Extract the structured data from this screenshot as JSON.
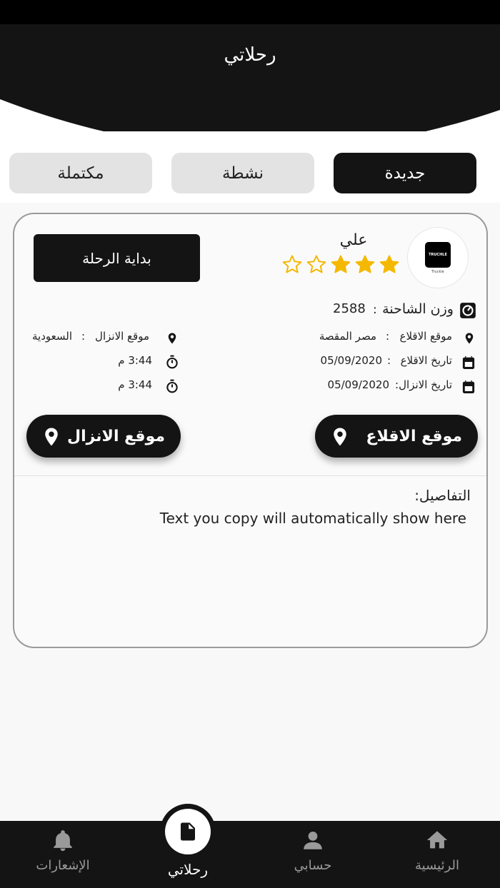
{
  "header": {
    "title": "رحلاتي"
  },
  "tabs": [
    {
      "label": "جديدة",
      "active": true
    },
    {
      "label": "نشطة",
      "active": false
    },
    {
      "label": "مكتملة",
      "active": false
    }
  ],
  "trip": {
    "driver_name": "علي",
    "rating": 3,
    "rating_max": 5,
    "logo_text": "TRUCHLE",
    "logo_subtext": "Truckle",
    "start_button": "بداية الرحلة",
    "truck_weight_label": "وزن الشاحنة",
    "truck_weight_value": "2588",
    "separator": ":",
    "pickup_label": "موقع الاقلاع",
    "pickup_value": "مصر المقصة",
    "dropoff_label": "موقع الانزال",
    "dropoff_value": "السعودية",
    "pickup_date_label": "تاريخ الاقلاع",
    "pickup_date_value": "05/09/2020",
    "dropoff_date_label": "تاريخ الانزال",
    "dropoff_date_value": "05/09/2020",
    "pickup_time": "3:44 م",
    "dropoff_time": "3:44 م",
    "pickup_button": "موقع الاقلاع",
    "dropoff_button": "موقع الانزال",
    "details_label": "التفاصيل:",
    "details_text": "Text you copy will automatically show here"
  },
  "nav": {
    "home": "الرئيسية",
    "account": "حسابي",
    "trips": "رحلاتي",
    "notifications": "الإشعارات"
  },
  "colors": {
    "dark": "#141414",
    "star": "#f5b800",
    "tab_inactive": "#e3e3e3"
  },
  "icons": [
    "location-pin-icon",
    "calendar-icon",
    "stopwatch-icon",
    "weight-icon",
    "star-icon",
    "home-icon",
    "person-icon",
    "document-icon",
    "bell-icon"
  ]
}
